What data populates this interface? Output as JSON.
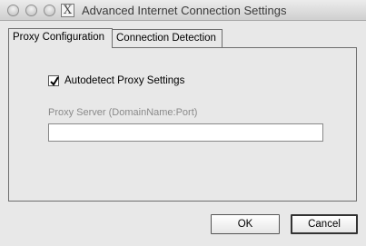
{
  "window": {
    "title": "Advanced Internet Connection Settings",
    "app_icon": "x-window-icon",
    "app_icon_glyph": "X"
  },
  "tabs": [
    {
      "label": "Proxy Configuration",
      "active": true
    },
    {
      "label": "Connection Detection",
      "active": false
    }
  ],
  "proxy": {
    "autodetect_label": "Autodetect Proxy Settings",
    "autodetect_checked": true,
    "server_label": "Proxy Server (DomainName:Port)",
    "server_value": ""
  },
  "buttons": {
    "ok_label": "OK",
    "cancel_label": "Cancel"
  }
}
